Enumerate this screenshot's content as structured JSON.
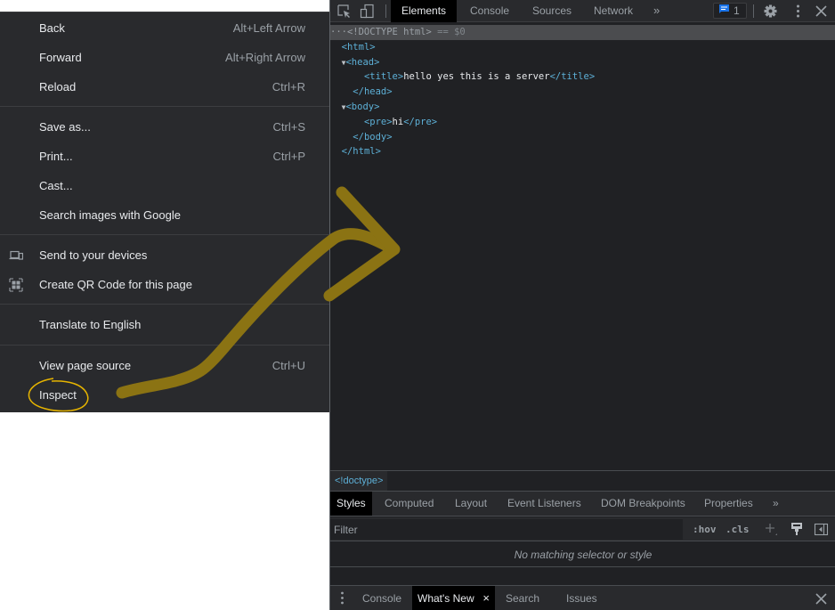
{
  "context_menu": {
    "items": [
      {
        "label": "Back",
        "shortcut": "Alt+Left Arrow"
      },
      {
        "label": "Forward",
        "shortcut": "Alt+Right Arrow"
      },
      {
        "label": "Reload",
        "shortcut": "Ctrl+R"
      },
      {
        "label": "Save as...",
        "shortcut": "Ctrl+S"
      },
      {
        "label": "Print...",
        "shortcut": "Ctrl+P"
      },
      {
        "label": "Cast..."
      },
      {
        "label": "Search images with Google"
      },
      {
        "label": "Send to your devices",
        "icon": "devices-icon"
      },
      {
        "label": "Create QR Code for this page",
        "icon": "qr-code-icon"
      },
      {
        "label": "Translate to English"
      },
      {
        "label": "View page source",
        "shortcut": "Ctrl+U"
      },
      {
        "label": "Inspect"
      }
    ]
  },
  "devtools": {
    "toolbar": {
      "tabs": [
        "Elements",
        "Console",
        "Sources",
        "Network"
      ],
      "active_tab": "Elements",
      "more": "»",
      "issues_count": "1"
    },
    "dom": {
      "doctype": "<!DOCTYPE html>",
      "selected_marker": "== $0",
      "ellipsis": "···",
      "lines": {
        "html_open": "<html>",
        "head_open": "<head>",
        "title_open": "<title>",
        "title_text": "hello yes this is a server",
        "title_close": "</title>",
        "head_close": "</head>",
        "body_open": "<body>",
        "pre_open": "<pre>",
        "pre_text": "hi",
        "pre_close": "</pre>",
        "body_close": "</body>",
        "html_close": "</html>"
      }
    },
    "breadcrumb": "<!doctype>",
    "styles_tabs": [
      "Styles",
      "Computed",
      "Layout",
      "Event Listeners",
      "DOM Breakpoints",
      "Properties"
    ],
    "styles_active": "Styles",
    "styles_more": "»",
    "filter": {
      "placeholder": "Filter",
      "hov": ":hov",
      "cls": ".cls"
    },
    "no_match_text": "No matching selector or style",
    "drawer": {
      "tabs": [
        "Console",
        "What's New",
        "Search",
        "Issues"
      ],
      "active": "What's New"
    }
  },
  "annotation": {
    "color": "#8b7313",
    "circle_color": "#e6b400"
  }
}
